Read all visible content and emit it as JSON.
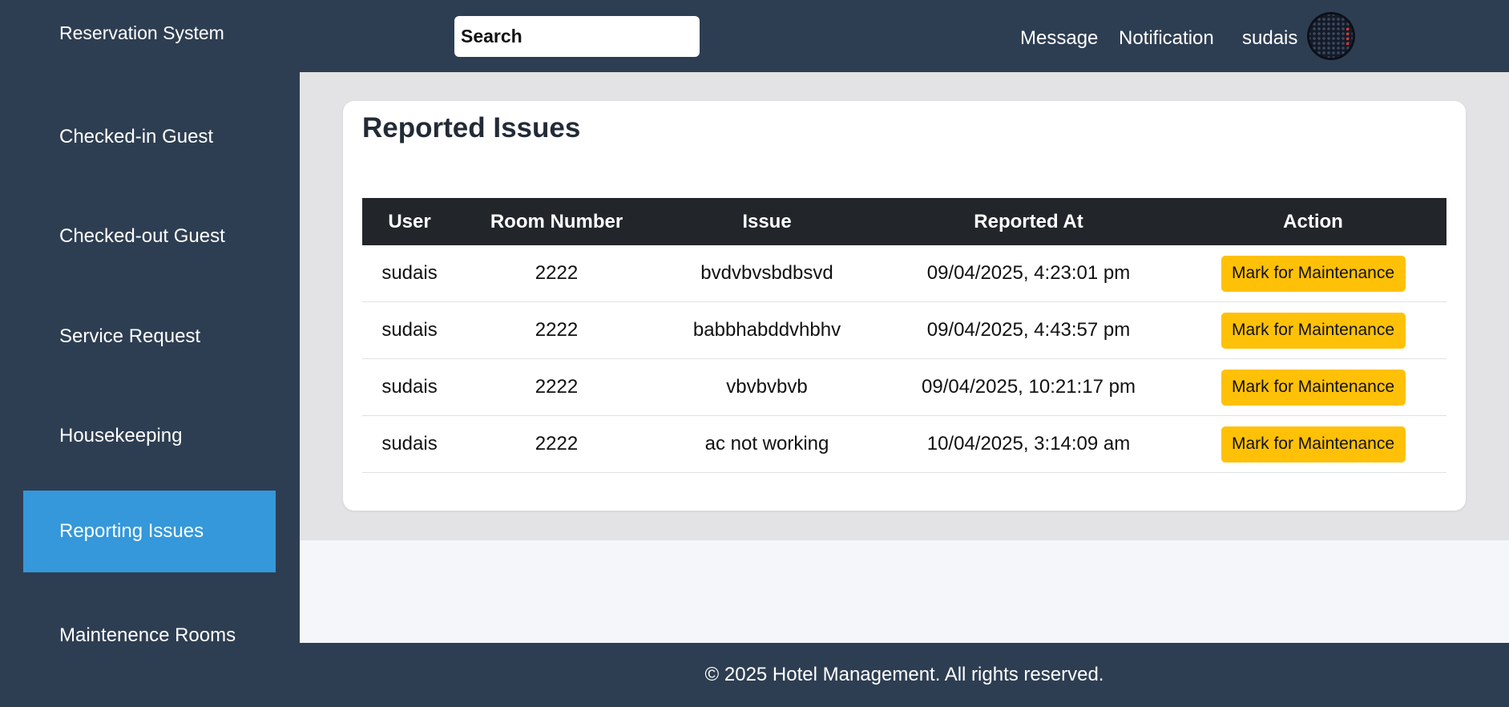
{
  "header": {
    "brand": "Reservation System",
    "search_placeholder": "Search",
    "message_label": "Message",
    "notification_label": "Notification",
    "username": "sudais"
  },
  "sidebar": {
    "items": [
      {
        "label": "Checked-in Guest",
        "active": false
      },
      {
        "label": "Checked-out Guest",
        "active": false
      },
      {
        "label": "Service Request",
        "active": false
      },
      {
        "label": "Housekeeping",
        "active": false
      },
      {
        "label": "Reporting Issues",
        "active": true
      },
      {
        "label": "Maintenence Rooms",
        "active": false
      }
    ]
  },
  "main": {
    "title": "Reported Issues",
    "table": {
      "headers": [
        "User",
        "Room Number",
        "Issue",
        "Reported At",
        "Action"
      ],
      "rows": [
        {
          "user": "sudais",
          "room": "2222",
          "issue": "bvdvbvsbdbsvd",
          "reported_at": "09/04/2025, 4:23:01 pm",
          "action": "Mark for Maintenance"
        },
        {
          "user": "sudais",
          "room": "2222",
          "issue": "babbhabddvhbhv",
          "reported_at": "09/04/2025, 4:43:57 pm",
          "action": "Mark for Maintenance"
        },
        {
          "user": "sudais",
          "room": "2222",
          "issue": "vbvbvbvb",
          "reported_at": "09/04/2025, 10:21:17 pm",
          "action": "Mark for Maintenance"
        },
        {
          "user": "sudais",
          "room": "2222",
          "issue": "ac not working",
          "reported_at": "10/04/2025, 3:14:09 am",
          "action": "Mark for Maintenance"
        }
      ]
    }
  },
  "footer": {
    "text": "© 2025 Hotel Management. All rights reserved."
  },
  "colors": {
    "navbar_bg": "#2e3e52",
    "active_nav": "#3498db",
    "table_header_bg": "#22262b",
    "button_warning": "#ffc107",
    "content_bg": "#e3e2e4"
  }
}
